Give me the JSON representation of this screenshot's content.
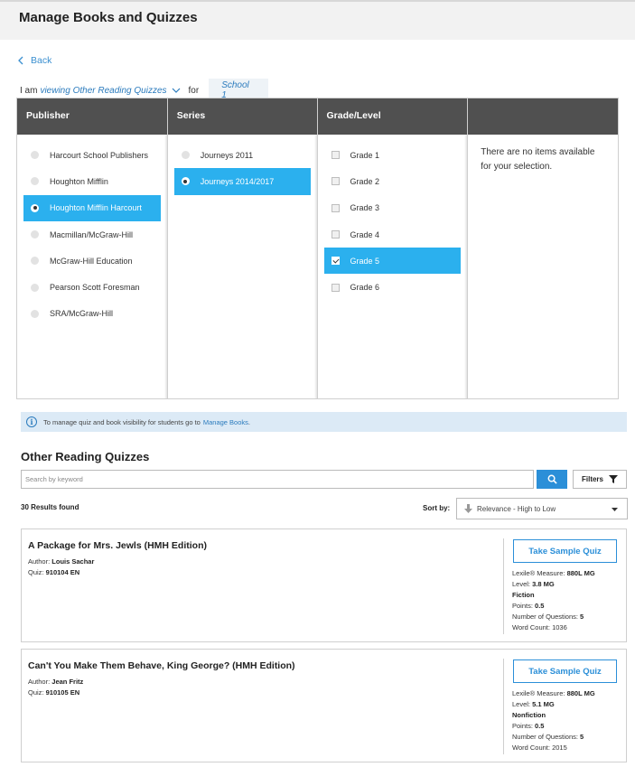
{
  "header": {
    "title": "Manage Books and Quizzes"
  },
  "back": {
    "label": "Back"
  },
  "context": {
    "prefix": "I am",
    "view": "viewing Other Reading Quizzes",
    "for": "for",
    "school": "School 1"
  },
  "columns": {
    "publisher": {
      "label": "Publisher",
      "items": [
        "Harcourt School Publishers",
        "Houghton Mifflin",
        "Houghton Mifflin Harcourt",
        "Macmillan/McGraw-Hill",
        "McGraw-Hill Education",
        "Pearson Scott Foresman",
        "SRA/McGraw-Hill"
      ],
      "selected": 2
    },
    "series": {
      "label": "Series",
      "items": [
        "Journeys 2011",
        "Journeys 2014/2017"
      ],
      "selected": 1
    },
    "grade": {
      "label": "Grade/Level",
      "items": [
        "Grade 1",
        "Grade 2",
        "Grade 3",
        "Grade 4",
        "Grade 5",
        "Grade 6"
      ],
      "selected": 4
    },
    "empty": {
      "label": "",
      "message": "There are no items available for your selection."
    }
  },
  "info": {
    "text": "To manage quiz and book visibility for students go to",
    "link": "Manage Books",
    "suffix": "."
  },
  "section": {
    "title": "Other Reading Quizzes"
  },
  "search": {
    "placeholder": "Search by keyword"
  },
  "filters": {
    "label": "Filters"
  },
  "results": {
    "count": "30 Results found"
  },
  "sort": {
    "label": "Sort by:",
    "value": "Relevance - High to Low"
  },
  "books": [
    {
      "title": "A Package for Mrs. Jewls (HMH Edition)",
      "author_label": "Author:",
      "author": "Louis Sachar",
      "quiz_label": "Quiz:",
      "quiz": "910104 EN",
      "button": "Take Sample Quiz",
      "lexile_label": "Lexile® Measure:",
      "lexile": "880L MG",
      "level_label": "Level:",
      "level": "3.8 MG",
      "genre": "Fiction",
      "points_label": "Points:",
      "points": "0.5",
      "questions_label": "Number of Questions:",
      "questions": "5",
      "words_label": "Word Count:",
      "words": "1036"
    },
    {
      "title": "Can't You Make Them Behave, King George? (HMH Edition)",
      "author_label": "Author:",
      "author": "Jean Fritz",
      "quiz_label": "Quiz:",
      "quiz": "910105 EN",
      "button": "Take Sample Quiz",
      "lexile_label": "Lexile® Measure:",
      "lexile": "880L MG",
      "level_label": "Level:",
      "level": "5.1 MG",
      "genre": "Nonfiction",
      "points_label": "Points:",
      "points": "0.5",
      "questions_label": "Number of Questions:",
      "questions": "5",
      "words_label": "Word Count:",
      "words": "2015"
    }
  ]
}
